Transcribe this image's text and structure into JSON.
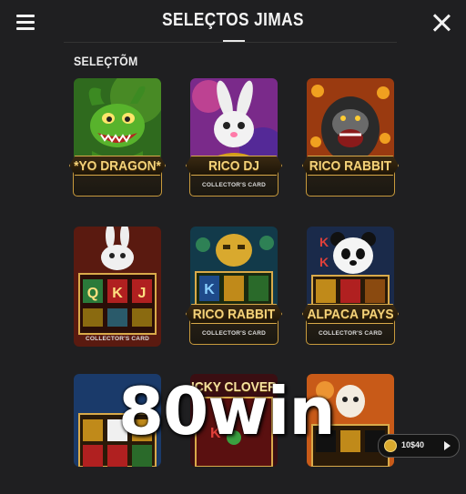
{
  "header": {
    "title": "SELEÇTOS JIMAS",
    "menu_icon": "hamburger-menu-icon",
    "close_icon": "close-icon"
  },
  "section": {
    "label": "SELEÇTÕM"
  },
  "games": [
    {
      "name": "*YO DRAGON*",
      "subtitle": ""
    },
    {
      "name": "RICO DJ",
      "subtitle": "COLLECTOR'S CARD"
    },
    {
      "name": "RICO RABBIT",
      "subtitle": ""
    },
    {
      "name": "",
      "subtitle": "COLLECTOR'S CARD"
    },
    {
      "name": "RICO RABBIT",
      "subtitle": "COLLECTOR'S CARD"
    },
    {
      "name": "ALPACA PAYS",
      "subtitle": "COLLECTOR'S CARD"
    },
    {
      "name": "",
      "subtitle": ""
    },
    {
      "name": "ICKY CLOVER",
      "subtitle": ""
    },
    {
      "name": "",
      "subtitle": ""
    }
  ],
  "watermark": "80win",
  "balance": {
    "value": "10$40"
  },
  "colors": {
    "background": "#1f1f21",
    "gold": "#d9aa4a",
    "gold_text": "#f3d27a"
  }
}
